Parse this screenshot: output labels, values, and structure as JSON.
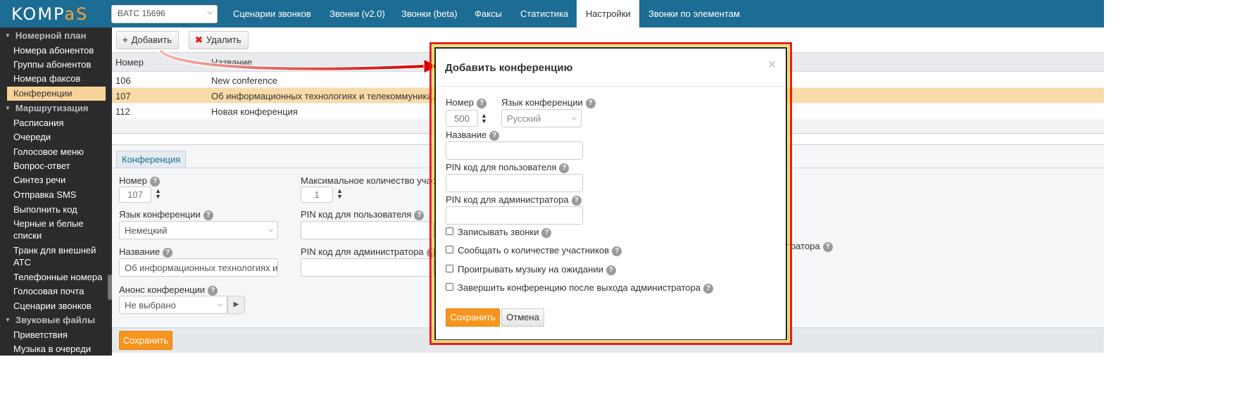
{
  "app": {
    "logo_left": "KOMP",
    "logo_accent": "aS",
    "ats_selector": "BATC 15696"
  },
  "nav": {
    "tabs": [
      "Сценарии звонков",
      "Звонки (v2.0)",
      "Звонки (beta)",
      "Факсы",
      "Статистика",
      "Настройки",
      "Звонки по элементам"
    ],
    "active_tab": "Настройки"
  },
  "sidebar": {
    "sections": [
      {
        "title": "Номерной план",
        "items": [
          "Номера абонентов",
          "Группы абонентов",
          "Номера факсов",
          "Конференции"
        ]
      },
      {
        "title": "Маршрутизация",
        "items": [
          "Расписания",
          "Очереди",
          "Голосовое меню",
          "Вопрос-ответ",
          "Синтез речи",
          "Отправка SMS",
          "Выполнить код",
          "Черные и белые списки",
          "Транк для внешней АТС",
          "Телефонные номера",
          "Голосовая почта",
          "Сценарии звонков"
        ]
      },
      {
        "title": "Звуковые файлы",
        "items": [
          "Приветствия",
          "Музыка в очереди"
        ]
      }
    ],
    "active_item": "Конференции"
  },
  "toolbar": {
    "add_icon": "+",
    "add_label": "Добавить",
    "delete_icon": "✖",
    "delete_label": "Удалить"
  },
  "grid": {
    "columns": [
      "Номер",
      "Название"
    ],
    "rows": [
      {
        "number": "106",
        "name": "New conference",
        "selected": false
      },
      {
        "number": "107",
        "name": "Об информационных технологиях и телекоммуникациях",
        "selected": true
      },
      {
        "number": "112",
        "name": "Новая конференция",
        "selected": false
      }
    ]
  },
  "detail_form": {
    "tab": "Конференция",
    "number_label": "Номер",
    "number_value": "107",
    "max_participants_label": "Максимальное количество участников",
    "max_participants_value": "1",
    "language_label": "Язык конференции",
    "language_value": "Немецкий",
    "user_pin_label": "PIN код для пользователя",
    "name_label": "Название",
    "name_value": "Об информационных технологиях и телекоммуникациях",
    "admin_pin_label": "PIN код для администратора",
    "announce_label": "Анонс конференции",
    "announce_value": "Не выбрано",
    "right_label_fragment": "тратора",
    "save_label": "Сохранить"
  },
  "modal": {
    "title": "Добавить конференцию",
    "close_glyph": "×",
    "number_label": "Номер",
    "number_value": "500",
    "language_label": "Язык конференции",
    "language_value": "Русский",
    "name_label": "Название",
    "user_pin_label": "PIN код для пользователя",
    "admin_pin_label": "PIN код для администратора",
    "checkboxes": [
      {
        "label": "Записывать звонки",
        "checked": false
      },
      {
        "label": "Сообщать о количестве участников",
        "checked": false
      },
      {
        "label": "Проигрывать музыку на ожидании",
        "checked": false
      },
      {
        "label": "Завершить конференцию после выхода администратора",
        "checked": false
      }
    ],
    "save_label": "Сохранить",
    "cancel_label": "Отмена"
  },
  "help_glyph": "?",
  "colors": {
    "header": "#1d6c93",
    "accent": "#f7941d",
    "sidebar": "#2b2b2b",
    "selected_row": "#f9dba7",
    "highlight_red": "#e51d1d",
    "highlight_yellow": "#f7d61d"
  }
}
